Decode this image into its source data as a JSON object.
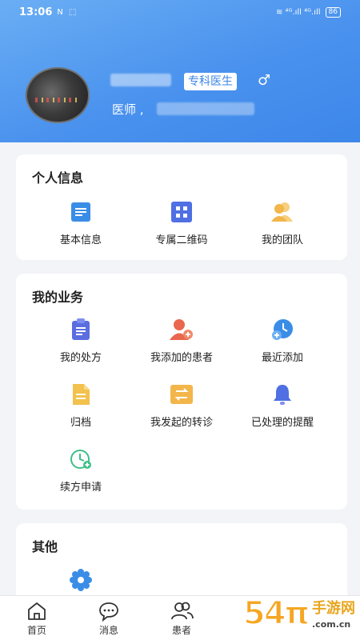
{
  "status_bar": {
    "time": "13:06",
    "left_icons": "N ⬚",
    "right_icons": "≋ ⁴ᴳ.ıll ⁴ᴳ.ıll",
    "battery": "86"
  },
  "profile": {
    "badge": "专科医生",
    "gender_symbol": "♂",
    "title": "医师",
    "separator": ","
  },
  "personal_info": {
    "title": "个人信息",
    "items": [
      {
        "label": "基本信息",
        "icon": "document-icon",
        "color": "#3a8de6"
      },
      {
        "label": "专属二维码",
        "icon": "qr-grid-icon",
        "color": "#4f6fe3"
      },
      {
        "label": "我的团队",
        "icon": "team-icon",
        "color": "#f2b64a"
      }
    ]
  },
  "business": {
    "title": "我的业务",
    "items": [
      {
        "label": "我的处方",
        "icon": "clipboard-icon",
        "color": "#5b6ee0"
      },
      {
        "label": "我添加的患者",
        "icon": "add-patient-icon",
        "color": "#e9674e"
      },
      {
        "label": "最近添加",
        "icon": "recent-add-icon",
        "color": "#3a8de6"
      },
      {
        "label": "归档",
        "icon": "archive-icon",
        "color": "#f2c14e"
      },
      {
        "label": "我发起的转诊",
        "icon": "transfer-icon",
        "color": "#f2b64a"
      },
      {
        "label": "已处理的提醒",
        "icon": "bell-icon",
        "color": "#4f6fe3"
      },
      {
        "label": "续方申请",
        "icon": "renew-clock-icon",
        "color": "#3dbf8a"
      }
    ]
  },
  "other": {
    "title": "其他",
    "items": [
      {
        "label": "",
        "icon": "settings-gear-icon",
        "color": "#3a8de6"
      }
    ]
  },
  "tabbar": {
    "items": [
      {
        "label": "首页",
        "icon": "home-icon"
      },
      {
        "label": "消息",
        "icon": "message-icon"
      },
      {
        "label": "患者",
        "icon": "patients-icon"
      }
    ]
  },
  "watermark": {
    "number": "54",
    "number2": "π",
    "cn": "手游网",
    "url": ".com.cn"
  },
  "colors": {
    "header_gradient_start": "#6aaef4",
    "header_gradient_end": "#3d87ea",
    "page_bg": "#f2f4f7"
  }
}
